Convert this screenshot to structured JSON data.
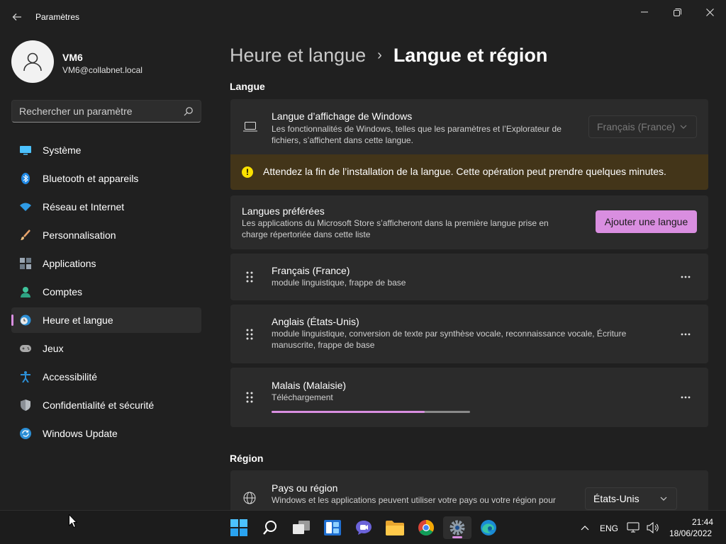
{
  "window": {
    "title": "Paramètres"
  },
  "profile": {
    "name": "VM6",
    "email": "VM6@collabnet.local"
  },
  "search": {
    "placeholder": "Rechercher un paramètre"
  },
  "sidebar": {
    "items": [
      {
        "label": "Système",
        "icon": "monitor-icon"
      },
      {
        "label": "Bluetooth et appareils",
        "icon": "bluetooth-icon"
      },
      {
        "label": "Réseau et Internet",
        "icon": "wifi-icon"
      },
      {
        "label": "Personnalisation",
        "icon": "brush-icon"
      },
      {
        "label": "Applications",
        "icon": "apps-icon"
      },
      {
        "label": "Comptes",
        "icon": "person-icon"
      },
      {
        "label": "Heure et langue",
        "icon": "clock-globe-icon",
        "selected": true
      },
      {
        "label": "Jeux",
        "icon": "gamepad-icon"
      },
      {
        "label": "Accessibilité",
        "icon": "accessibility-icon"
      },
      {
        "label": "Confidentialité et sécurité",
        "icon": "shield-icon"
      },
      {
        "label": "Windows Update",
        "icon": "update-icon"
      }
    ]
  },
  "breadcrumb": {
    "parent": "Heure et langue",
    "separator": "›",
    "current": "Langue et région"
  },
  "language_section": {
    "title": "Langue",
    "display_language": {
      "title": "Langue d’affichage de Windows",
      "desc": "Les fonctionnalités de Windows, telles que les paramètres et l’Explorateur de fichiers, s’affichent dans cette langue.",
      "value": "Français (France)"
    },
    "warning": "Attendez la fin de l’installation de la langue. Cette opération peut prendre quelques minutes.",
    "preferred": {
      "title": "Langues préférées",
      "desc": "Les applications du Microsoft Store s’afficheront dans la première langue prise en charge répertoriée dans cette liste",
      "button": "Ajouter une langue"
    },
    "languages": [
      {
        "name": "Français (France)",
        "details": "module linguistique, frappe de base"
      },
      {
        "name": "Anglais (États-Unis)",
        "details": "module linguistique, conversion de texte par synthèse vocale, reconnaissance vocale, Écriture manuscrite, frappe de base"
      },
      {
        "name": "Malais (Malaisie)",
        "details": "Téléchargement",
        "progress": 0.77
      }
    ]
  },
  "region_section": {
    "title": "Région",
    "country": {
      "title": "Pays ou région",
      "desc": "Windows et les applications peuvent utiliser votre pays ou votre région pour",
      "value": "États-Unis"
    }
  },
  "taskbar": {
    "apps": [
      "windows-start-icon",
      "search-icon",
      "task-view-icon",
      "widgets-icon",
      "teams-chat-icon",
      "file-explorer-icon",
      "chrome-icon",
      "settings-icon",
      "edge-icon"
    ],
    "language": "ENG",
    "time": "21:44",
    "date": "18/06/2022"
  },
  "colors": {
    "accent": "#d98ee0",
    "warning_bg": "#433519",
    "warning_icon": "#fce100"
  }
}
